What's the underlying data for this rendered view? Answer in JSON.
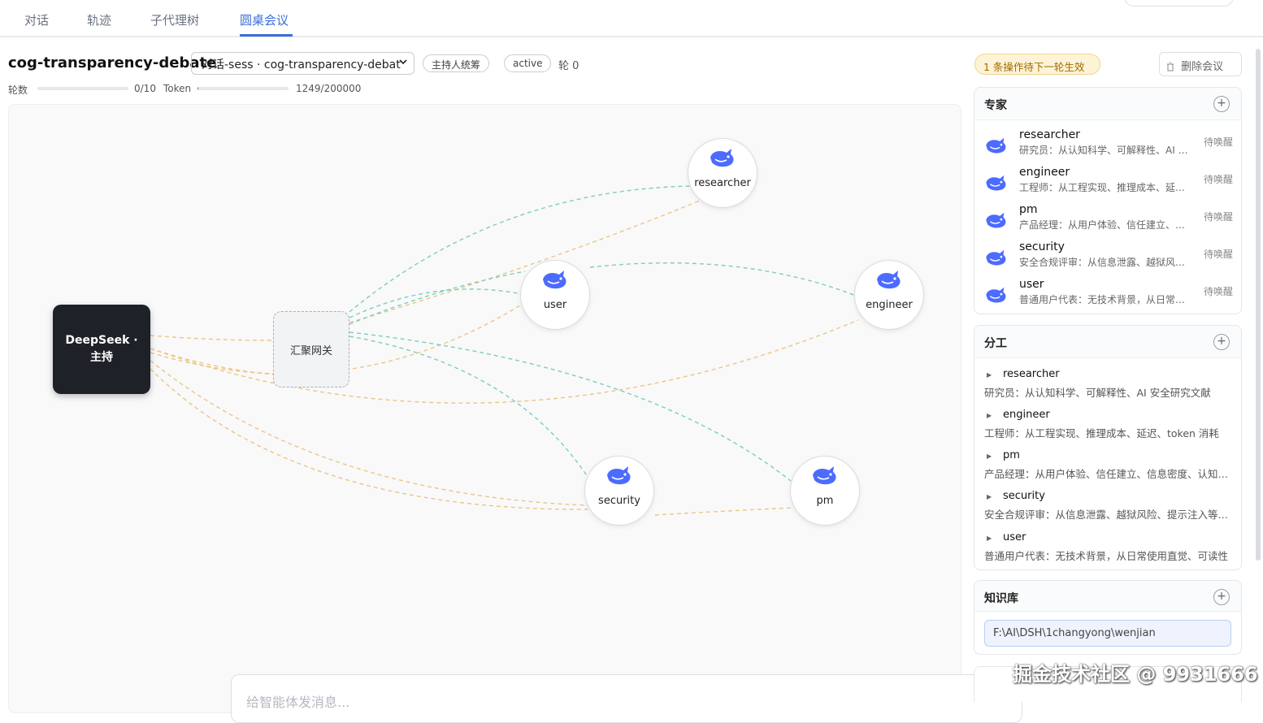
{
  "tabs": [
    {
      "label": "对话",
      "active": false
    },
    {
      "label": "轨迹",
      "active": false
    },
    {
      "label": "子代理树",
      "active": false
    },
    {
      "label": "圆桌会议",
      "active": true
    }
  ],
  "meeting": {
    "title": "cog-transparency-debate",
    "session_value": "对话-sess · cog-transparency-debat",
    "mode_badge": "主持人统筹",
    "status_badge": "active",
    "round_label": "轮 0",
    "rounds_label": "轮数",
    "rounds_value": "0/10",
    "rounds_fraction": 0.0,
    "token_label": "Token",
    "token_value": "1249/200000",
    "token_fraction": 0.006,
    "pending_notice": "1 条操作待下一轮生效",
    "delete_label": "删除会议"
  },
  "graph": {
    "host_label": "DeepSeek · 主持",
    "gateway_label": "汇聚网关",
    "agents": [
      {
        "id": "researcher",
        "label": "researcher"
      },
      {
        "id": "user",
        "label": "user"
      },
      {
        "id": "engineer",
        "label": "engineer"
      },
      {
        "id": "security",
        "label": "security"
      },
      {
        "id": "pm",
        "label": "pm"
      }
    ],
    "edge_colors": {
      "teal": "#7fcdbb",
      "amber": "#ebc684"
    }
  },
  "input": {
    "placeholder": "给智能体发消息..."
  },
  "experts_panel": {
    "title": "专家",
    "items": [
      {
        "name": "researcher",
        "desc": "研究员：从认知科学、可解释性、AI 安全研究文献",
        "status": "待唤醒"
      },
      {
        "name": "engineer",
        "desc": "工程师：从工程实现、推理成本、延迟、token 消耗",
        "status": "待唤醒"
      },
      {
        "name": "pm",
        "desc": "产品经理：从用户体验、信任建立、信息密度",
        "status": "待唤醒"
      },
      {
        "name": "security",
        "desc": "安全合规评审：从信息泄露、越狱风险、提示注入",
        "status": "待唤醒"
      },
      {
        "name": "user",
        "desc": "普通用户代表：无技术背景，从日常使用直觉",
        "status": "待唤醒"
      }
    ]
  },
  "tasks_panel": {
    "title": "分工",
    "items": [
      {
        "name": "researcher",
        "desc": "研究员：从认知科学、可解释性、AI 安全研究文献"
      },
      {
        "name": "engineer",
        "desc": "工程师：从工程实现、推理成本、延迟、token 消耗"
      },
      {
        "name": "pm",
        "desc": "产品经理：从用户体验、信任建立、信息密度、认知负担"
      },
      {
        "name": "security",
        "desc": "安全合规评审：从信息泄露、越狱风险、提示注入等角度"
      },
      {
        "name": "user",
        "desc": "普通用户代表：无技术背景，从日常使用直觉、可读性"
      }
    ]
  },
  "kb_panel": {
    "title": "知识库",
    "path": "F:\\AI\\DSH\\1changyong\\wenjian"
  },
  "watermark": "掘金技术社区 @ 9931666",
  "colors": {
    "accent": "#3b6fd8",
    "host": "#1e2128",
    "whale": "#4d6bfe"
  }
}
